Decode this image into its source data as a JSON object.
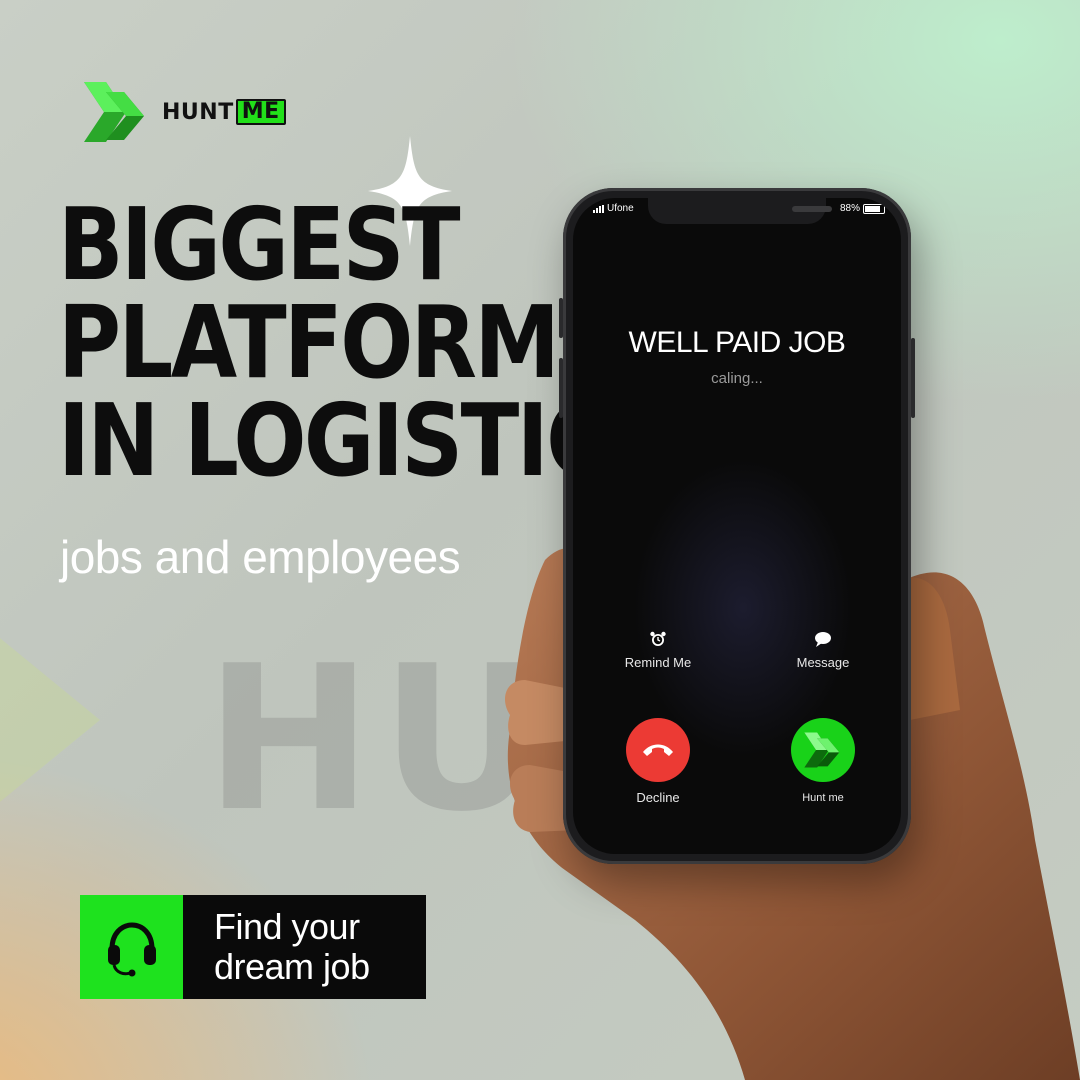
{
  "brand": {
    "name_part1": "HUNT",
    "name_part2": "ME",
    "accent": "#22e01a"
  },
  "headline": {
    "line1": "BIGGEST",
    "line2": "PLATFORM",
    "line3": "IN LOGISTICS"
  },
  "subheadline": "jobs and employees",
  "watermark": "HU",
  "phone": {
    "carrier": "Ufone",
    "battery": "88%",
    "caller_name": "WELL PAID JOB",
    "call_status": "caling...",
    "remind_label": "Remind Me",
    "message_label": "Message",
    "decline_label": "Decline",
    "accept_label": "Hunt me",
    "decline_color": "#ec3a34",
    "accept_color": "#19d219"
  },
  "cta": {
    "line1": "Find your",
    "line2": "dream job",
    "icon": "headset-icon"
  }
}
